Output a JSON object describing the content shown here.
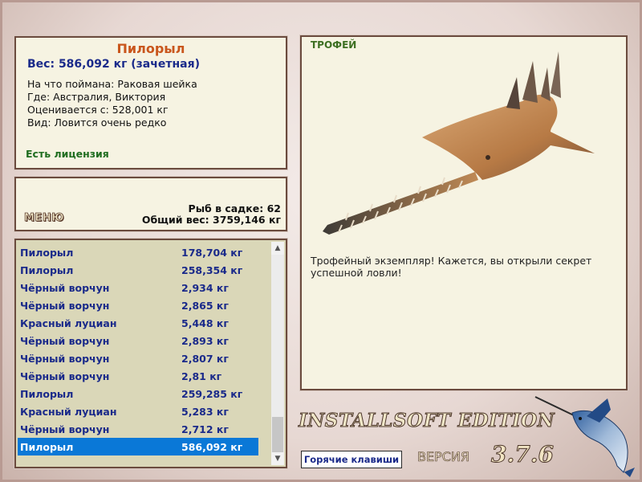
{
  "info": {
    "fish_name": "Пилорыл",
    "weight_line": "Вес: 586,092 кг (зачетная)",
    "caught_on": "На что поймана: Раковая шейка",
    "where": "Где: Австралия, Виктория",
    "valued": "Оценивается с: 528,001 кг",
    "kind": "Вид: Ловится очень редко",
    "license": "Есть лицензия"
  },
  "stats": {
    "menu_label": "МЕНЮ",
    "fish_count": "Рыб в садке: 62",
    "total_weight": "Общий вес: 3759,146 кг"
  },
  "list": {
    "rows": [
      {
        "name": "Пилорыл",
        "weight": "178,704 кг"
      },
      {
        "name": "Пилорыл",
        "weight": "258,354 кг"
      },
      {
        "name": "Чёрный ворчун",
        "weight": "2,934 кг"
      },
      {
        "name": "Чёрный ворчун",
        "weight": "2,865 кг"
      },
      {
        "name": "Красный луциан",
        "weight": "5,448 кг"
      },
      {
        "name": "Чёрный ворчун",
        "weight": "2,893 кг"
      },
      {
        "name": "Чёрный ворчун",
        "weight": "2,807 кг"
      },
      {
        "name": "Чёрный ворчун",
        "weight": "2,81 кг"
      },
      {
        "name": "Пилорыл",
        "weight": "259,285 кг"
      },
      {
        "name": "Красный луциан",
        "weight": "5,283 кг"
      },
      {
        "name": "Чёрный ворчун",
        "weight": "2,712 кг"
      },
      {
        "name": "Пилорыл",
        "weight": "586,092 кг"
      }
    ],
    "selected_index": 11
  },
  "trophy": {
    "label": "ТРОФЕЙ",
    "description": "Трофейный экземпляр! Кажется, вы открыли секрет успешной ловли!"
  },
  "footer": {
    "hotkeys": "Горячие клавиши",
    "edition": "INSTALLSOFT EDITION",
    "version_label": "ВЕРСИЯ",
    "version_number": "3.7.6"
  },
  "colors": {
    "panel_bg": "#f6f3e2",
    "list_bg": "#dad7b8",
    "selection": "#0a78d7",
    "title_orange": "#c9561c",
    "text_blue": "#1a2a8a",
    "license_green": "#1f6d1f"
  }
}
